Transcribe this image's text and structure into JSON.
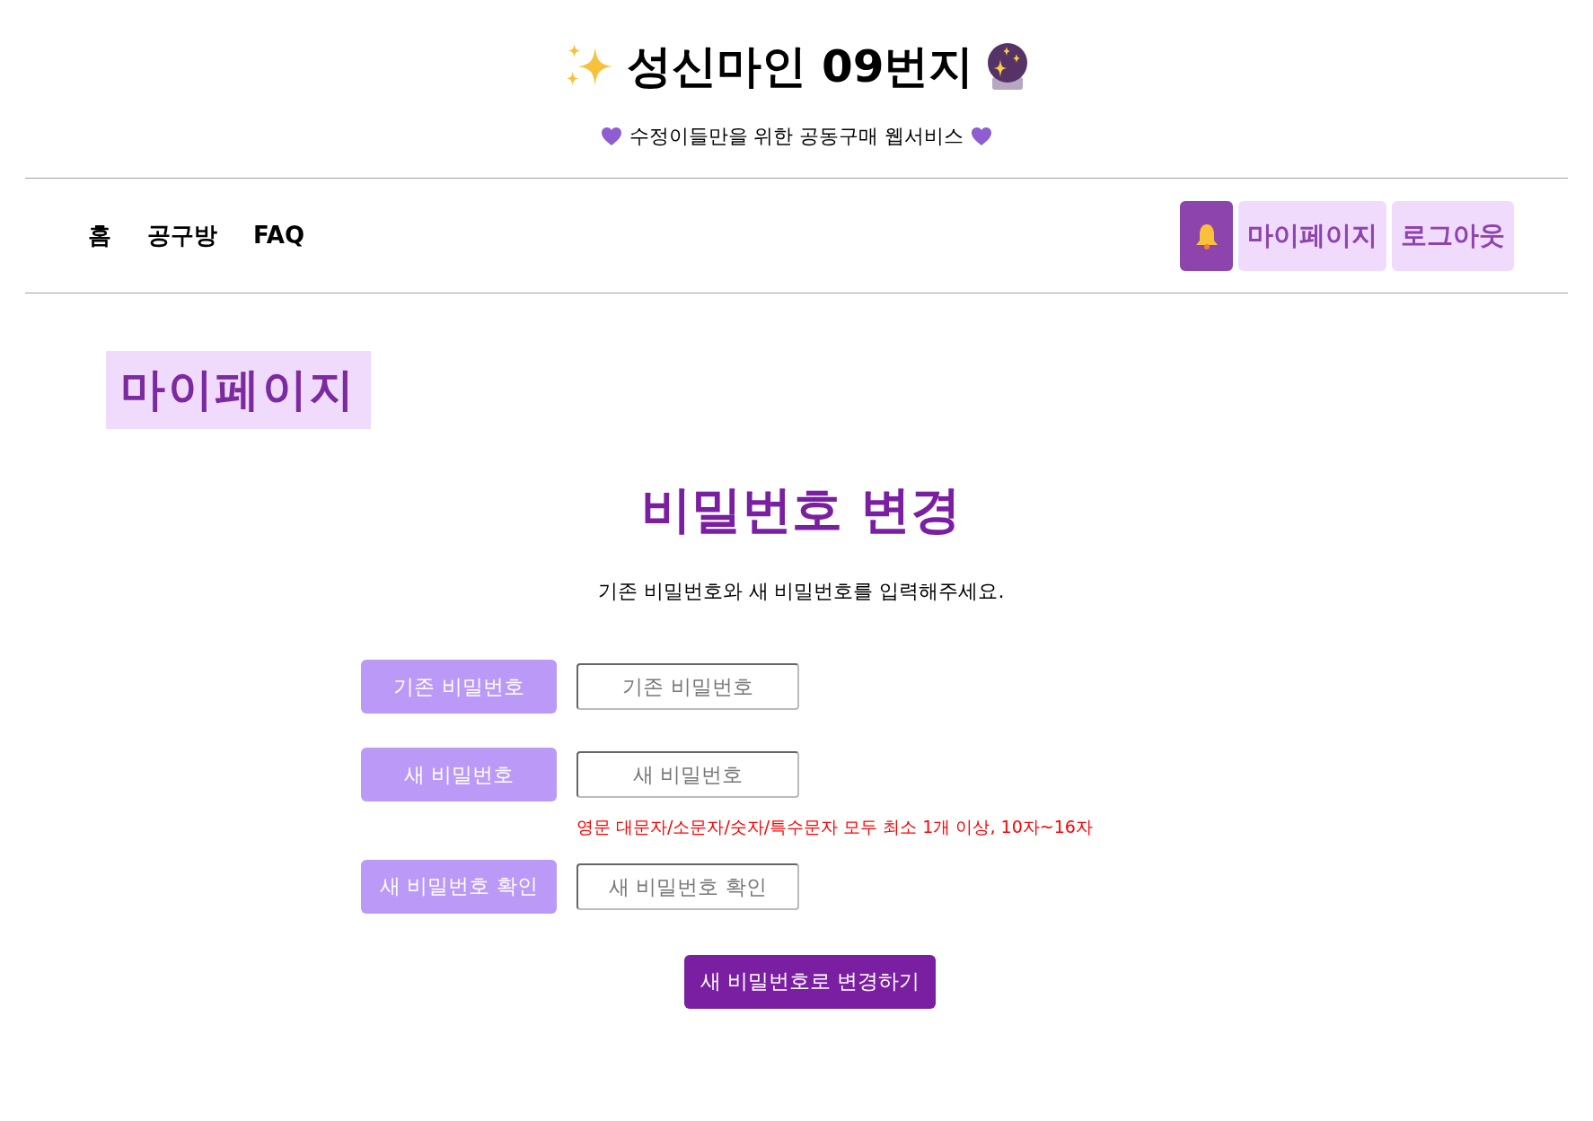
{
  "header": {
    "title": "성신마인 09번지",
    "subtitle": "수정이들만을 위한 공동구매 웹서비스"
  },
  "nav": {
    "links": [
      {
        "label": "홈"
      },
      {
        "label": "공구방"
      },
      {
        "label": "FAQ"
      }
    ],
    "buttons": [
      {
        "label": "마이페이지"
      },
      {
        "label": "로그아웃"
      }
    ]
  },
  "page_title": "마이페이지",
  "form": {
    "title": "비밀번호 변경",
    "description": "기존 비밀번호와 새 비밀번호를 입력해주세요.",
    "fields": [
      {
        "label": "기존 비밀번호",
        "placeholder": "기존 비밀번호"
      },
      {
        "label": "새 비밀번호",
        "placeholder": "새 비밀번호",
        "hint": "영문 대문자/소문자/숫자/특수문자 모두 최소 1개 이상, 10자~16자"
      },
      {
        "label": "새 비밀번호 확인",
        "placeholder": "새 비밀번호 확인"
      }
    ],
    "submit": "새 비밀번호로 변경하기"
  }
}
